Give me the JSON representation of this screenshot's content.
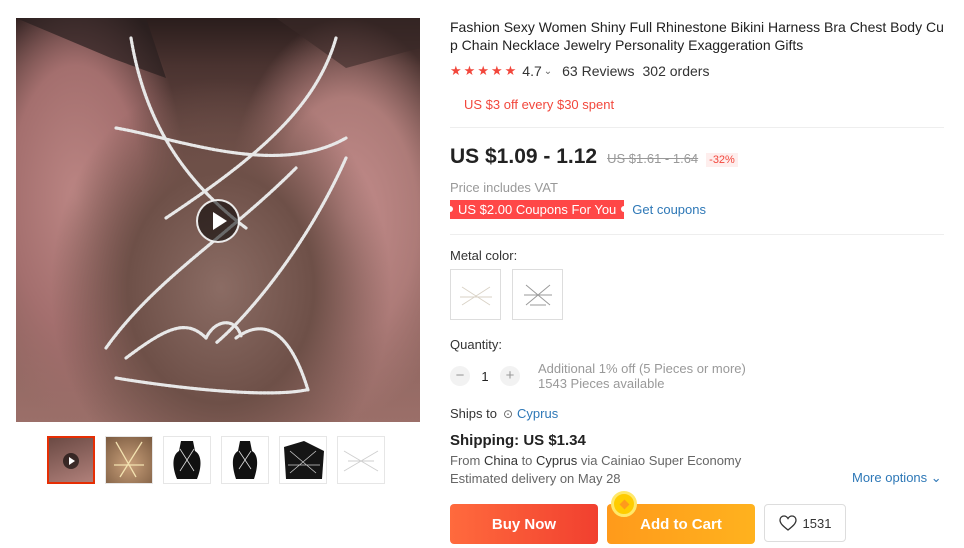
{
  "product": {
    "title": "Fashion Sexy Women Shiny Full Rhinestone Bikini Harness Bra Chest Body Cup Chain Necklace Jewelry Personality Exaggeration Gifts",
    "rating": "4.7",
    "rating_stars": 5,
    "reviews": "63 Reviews",
    "orders": "302 orders",
    "promo": "US $3 off every $30 spent",
    "price": "US $1.09 - 1.12",
    "old_price": "US $1.61 - 1.64",
    "discount": "-32%",
    "vat_note": "Price includes VAT",
    "coupon_tag": "US $2.00 Coupons For You",
    "get_coupons": "Get coupons"
  },
  "variants": {
    "label": "Metal color:",
    "options": [
      {
        "name": "gold-variant",
        "icon": "harness-gold-swatch"
      },
      {
        "name": "silver-variant",
        "icon": "harness-silver-swatch"
      }
    ]
  },
  "quantity": {
    "label": "Quantity:",
    "value": "1",
    "decrement": "−",
    "increment": "+",
    "extra_line1": "Additional 1% off (5 Pieces or more)",
    "extra_line2": "1543 Pieces available"
  },
  "shipping": {
    "ships_to_label": "Ships to",
    "country": "Cyprus",
    "cost": "Shipping: US $1.34",
    "from_label": "From",
    "from_country": "China",
    "to_label": "to",
    "to_country": "Cyprus",
    "via": "via Cainiao Super Economy",
    "estimated": "Estimated delivery on May 28",
    "more_options": "More options"
  },
  "actions": {
    "buy_now": "Buy Now",
    "add_to_cart": "Add to Cart",
    "wishlist_count": "1531"
  },
  "gallery": {
    "thumbnails": [
      "video-thumb",
      "gold-harness-thumb",
      "black-mannequin-thumb-1",
      "black-mannequin-thumb-2",
      "black-mannequin-thumb-3",
      "white-flatlay-thumb"
    ]
  },
  "colors": {
    "accent": "#f2473c",
    "link": "#2e78b7",
    "buy_now": "#f1402f",
    "add_to_cart": "#ffa41e"
  }
}
